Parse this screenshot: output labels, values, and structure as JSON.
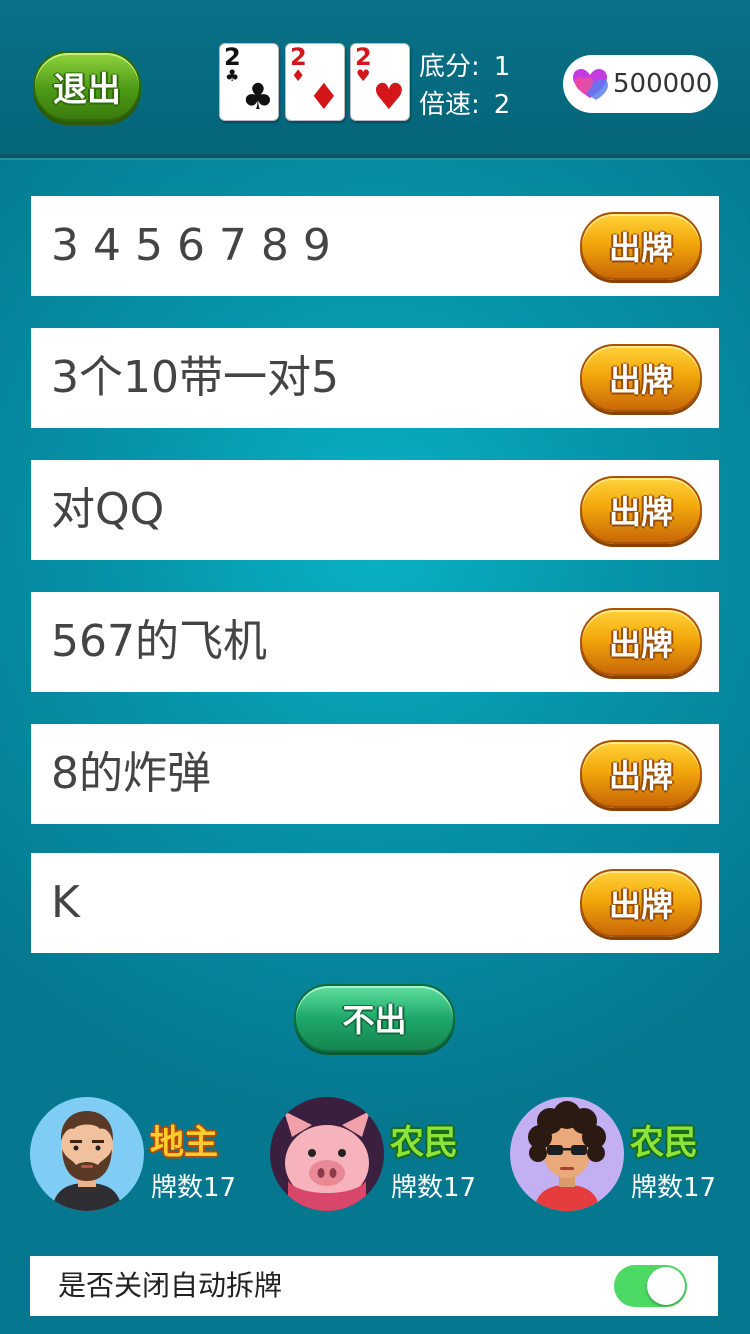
{
  "header": {
    "exit_label": "退出",
    "cards": [
      {
        "rank": "2",
        "suit": "♣",
        "color": "#111111"
      },
      {
        "rank": "2",
        "suit": "♦",
        "color": "#d4161a"
      },
      {
        "rank": "2",
        "suit": "♥",
        "color": "#d4161a"
      }
    ],
    "base_score_label": "底分:",
    "base_score_value": "1",
    "multiplier_label": "倍速:",
    "multiplier_value": "2",
    "coins": "500000",
    "coin_icon": "hearts-icon"
  },
  "options": [
    {
      "text": "3 4 5 6 7 8 9",
      "button": "出牌"
    },
    {
      "text": "3个10带一对5",
      "button": "出牌"
    },
    {
      "text": "对QQ",
      "button": "出牌"
    },
    {
      "text": "567的飞机",
      "button": "出牌"
    },
    {
      "text": "8的炸弹",
      "button": "出牌"
    },
    {
      "text": "K",
      "button": "出牌"
    }
  ],
  "pass_label": "不出",
  "players": [
    {
      "role": "地主",
      "count_label": "牌数17",
      "avatar": "bearded-man-avatar"
    },
    {
      "role": "农民",
      "count_label": "牌数17",
      "avatar": "pig-avatar"
    },
    {
      "role": "农民",
      "count_label": "牌数17",
      "avatar": "curly-hair-sunglasses-avatar"
    }
  ],
  "auto_split": {
    "label": "是否关闭自动拆牌",
    "enabled": true,
    "color": "#4cd964"
  }
}
